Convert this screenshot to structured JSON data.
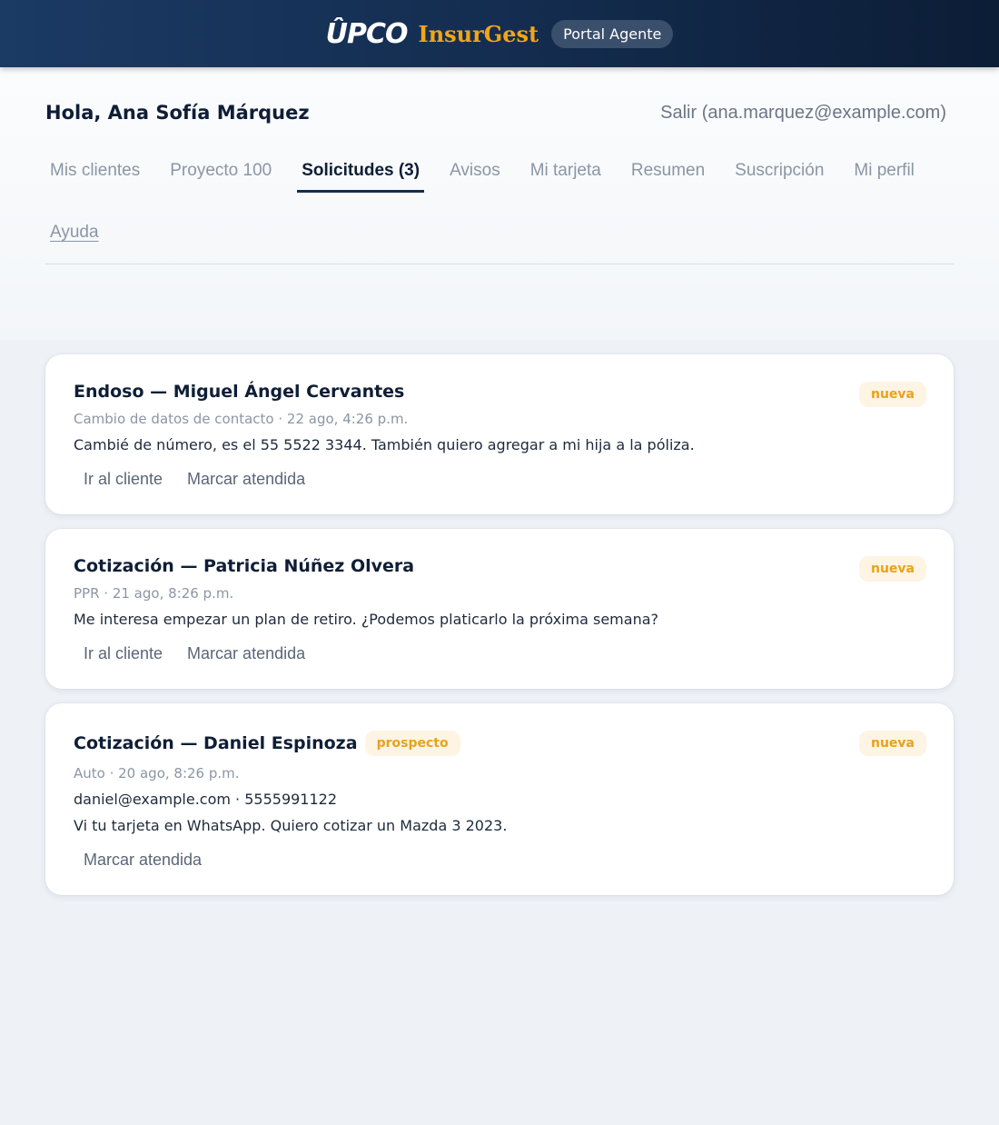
{
  "topbar": {
    "logo_upco": "ÛPCO",
    "logo_insurgest": "InsurGest",
    "portal_label": "Portal Agente"
  },
  "header": {
    "greeting": "Hola, Ana Sofía Márquez",
    "logout": "Salir (ana.marquez@example.com)"
  },
  "tabs": [
    {
      "label": "Mis clientes"
    },
    {
      "label": "Proyecto 100"
    },
    {
      "label": "Solicitudes (3)"
    },
    {
      "label": "Avisos"
    },
    {
      "label": "Mi tarjeta"
    },
    {
      "label": "Resumen"
    },
    {
      "label": "Suscripción"
    },
    {
      "label": "Mi perfil"
    },
    {
      "label": "Ayuda"
    }
  ],
  "active_tab": "Solicitudes (3)",
  "requests": [
    {
      "title": "Endoso — Miguel Ángel Cervantes",
      "status": "nueva",
      "meta": "Cambio de datos de contacto · 22 ago, 4:26 p.m.",
      "message": "Cambié de número, es el 55 5522 3344. También quiero agregar a mi hija a la póliza.",
      "action_client": "Ir al cliente",
      "action_done": "Marcar atendida"
    },
    {
      "title": "Cotización — Patricia Núñez Olvera",
      "status": "nueva",
      "meta": "PPR · 21 ago, 8:26 p.m.",
      "message": "Me interesa empezar un plan de retiro. ¿Podemos platicarlo la próxima semana?",
      "action_client": "Ir al cliente",
      "action_done": "Marcar atendida"
    },
    {
      "title": "Cotización — Daniel Espinoza",
      "tag": "prospecto",
      "status": "nueva",
      "meta": "Auto · 20 ago, 8:26 p.m.",
      "contact": "daniel@example.com · 5555991122",
      "message": "Vi tu tarjeta en WhatsApp. Quiero cotizar un Mazda 3 2023.",
      "action_done": "Marcar atendida"
    }
  ],
  "colors": {
    "navy": "#142d50",
    "accent_orange": "#f2a516",
    "pill_bg": "#fdf4e4",
    "muted_text": "#8b96a5"
  }
}
